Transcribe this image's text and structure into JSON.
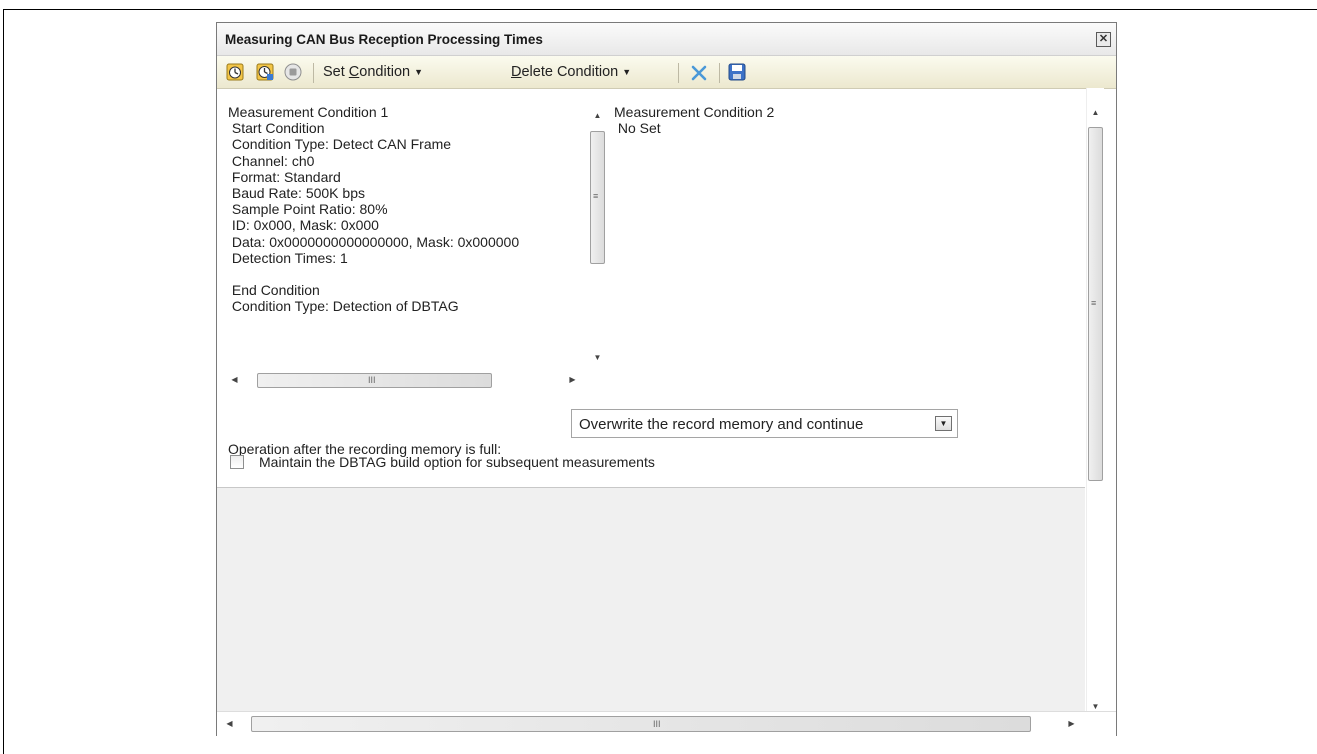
{
  "window": {
    "title": "Measuring CAN Bus Reception Processing Times",
    "close_glyph": "✕"
  },
  "toolbar": {
    "icons": [
      "run-measure-icon",
      "run-measure-alt-icon",
      "stop-icon"
    ],
    "set_condition": {
      "prefix": "Set ",
      "accel": "C",
      "rest": "ondition"
    },
    "delete_condition": {
      "prefix": "",
      "accel": "D",
      "rest": "elete Condition"
    },
    "delete_icon": "delete-x-icon",
    "save_icon": "save-disk-icon",
    "accent_color": "#4a98d8"
  },
  "condition1": {
    "title": "Measurement Condition 1",
    "text": "Measurement Condition 1\n Start Condition\n Condition Type: Detect CAN Frame\n Channel: ch0\n Format: Standard\n Baud Rate: 500K bps\n Sample Point Ratio: 80%\n ID: 0x000, Mask: 0x000\n Data: 0x0000000000000000, Mask: 0x000000\n Detection Times: 1\n\n End Condition\n Condition Type: Detection of DBTAG"
  },
  "condition2": {
    "text": "Measurement Condition 2\n No Set"
  },
  "scroll_glyphs": {
    "up": "▲",
    "down": "▼",
    "left": "◀",
    "right": "▶",
    "grip_v": "≡",
    "grip_h": "III"
  },
  "operation": {
    "label": "Operation after the recording memory is full:",
    "value": "Overwrite the record memory and continue",
    "dropdown_glyph": "▼"
  },
  "maintain_checkbox": {
    "label": "Maintain the DBTAG build option for subsequent measurements",
    "checked": false
  }
}
